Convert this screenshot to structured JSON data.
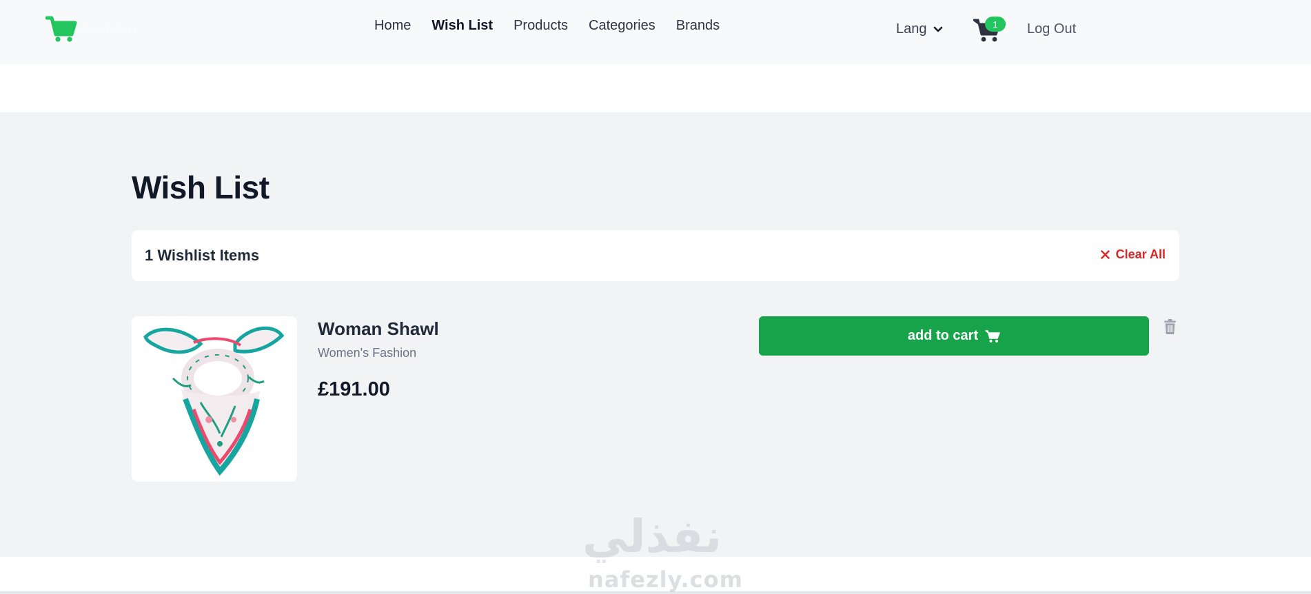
{
  "brand": {
    "name": "FreshCart",
    "accent": "#16a34a"
  },
  "nav": {
    "links": [
      {
        "label": "Home"
      },
      {
        "label": "Wish List"
      },
      {
        "label": "Products"
      },
      {
        "label": "Categories"
      },
      {
        "label": "Brands"
      }
    ],
    "active": "Wish List",
    "lang_label": "Lang",
    "cart_count": "1",
    "logout_label": "Log Out"
  },
  "page": {
    "title": "Wish List",
    "summary_count": "1 Wishlist Items",
    "clear_all_label": "Clear All"
  },
  "items": [
    {
      "name": "Woman Shawl",
      "category": "Women's Fashion",
      "price": "£191.00",
      "add_to_cart_label": "add to cart",
      "image": "shawl-scarf"
    }
  ],
  "watermark": {
    "arabic": "نفذلي",
    "latin": "nafezly.com"
  },
  "colors": {
    "danger": "#dc2626",
    "badge": "#22c55e",
    "page_bg": "#f2f3f5"
  }
}
